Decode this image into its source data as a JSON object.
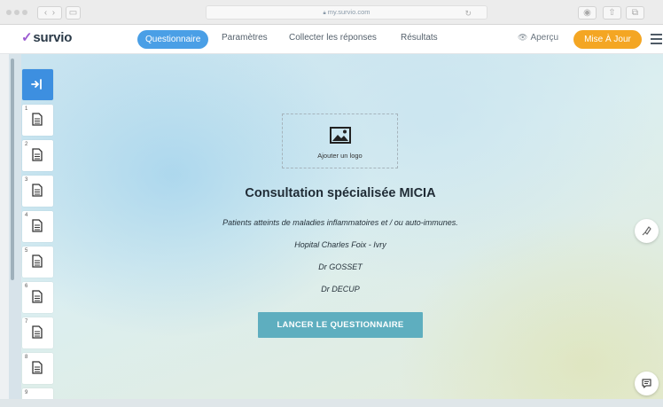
{
  "browser": {
    "url": "my.survio.com"
  },
  "header": {
    "brand": "survio",
    "tabs": [
      {
        "label": "Questionnaire",
        "active": true
      },
      {
        "label": "Paramètres",
        "active": false
      },
      {
        "label": "Collecter les réponses",
        "active": false
      },
      {
        "label": "Résultats",
        "active": false
      }
    ],
    "preview_label": "Aperçu",
    "upgrade_label": "Mise À Jour",
    "accent_color": "#4a9fe6",
    "upgrade_color": "#f4a623"
  },
  "sidebar": {
    "questions": [
      "1",
      "2",
      "3",
      "4",
      "5",
      "6",
      "7",
      "8",
      "9"
    ]
  },
  "survey": {
    "logo_placeholder": "Ajouter un logo",
    "title": "Consultation spécialisée MICIA",
    "lines": [
      "Patients atteints de maladies inflammatoires et / ou auto-immunes.",
      "Hopital Charles Foix - Ivry",
      "Dr GOSSET",
      "Dr DECUP"
    ],
    "start_button": "LANCER LE QUESTIONNAIRE",
    "start_button_color": "#5eaebf"
  }
}
